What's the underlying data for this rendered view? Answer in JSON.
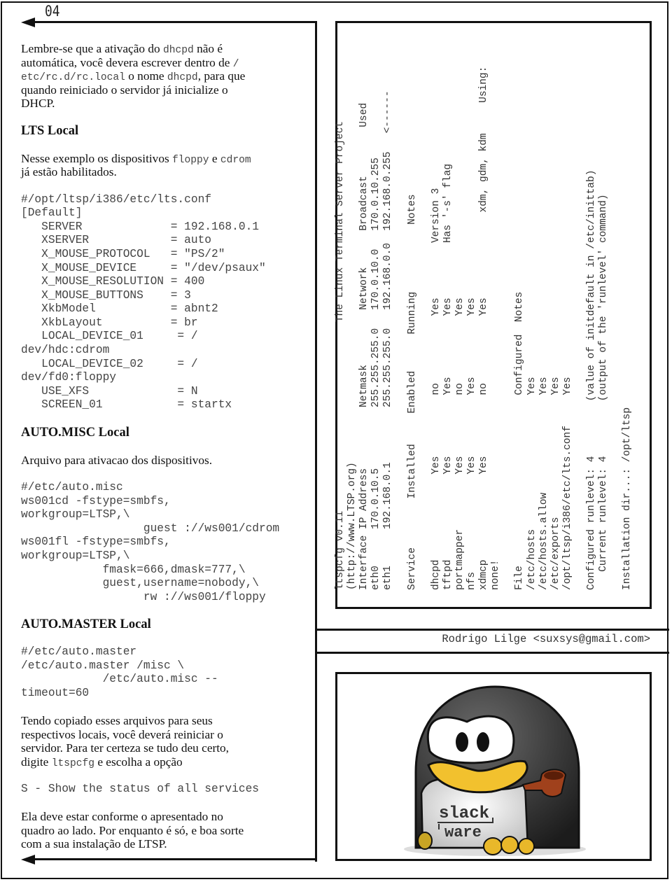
{
  "page_number": "04",
  "left": {
    "blocks": [
      {
        "type": "para",
        "lines": [
          [
            {
              "text": "Lembre-se que a ativação do "
            },
            {
              "text": "dhcpd",
              "code": true
            },
            {
              "text": " não é"
            }
          ],
          [
            {
              "text": "automática, você devera escrever dentro de "
            },
            {
              "text": "/",
              "code": true
            }
          ],
          [
            {
              "text": "etc/rc.d/rc.local",
              "code": true
            },
            {
              "text": " o nome "
            },
            {
              "text": "dhcpd",
              "code": true
            },
            {
              "text": ", para que"
            }
          ],
          [
            {
              "text": "quando reiniciado o servidor já inicialize o"
            }
          ],
          [
            {
              "text": "DHCP."
            }
          ]
        ]
      },
      {
        "type": "heading",
        "text": "LTS Local"
      },
      {
        "type": "para",
        "lines": [
          [
            {
              "text": "Nesse exemplo os dispositivos "
            },
            {
              "text": "floppy",
              "code": true
            },
            {
              "text": " e "
            },
            {
              "text": "cdrom",
              "code": true
            }
          ],
          [
            {
              "text": "já estão habilitados."
            }
          ]
        ]
      },
      {
        "type": "code",
        "lines": [
          "#/opt/ltsp/i386/etc/lts.conf",
          "[Default]",
          "   SERVER             = 192.168.0.1",
          "   XSERVER            = auto",
          "   X_MOUSE_PROTOCOL   = \"PS/2\"",
          "   X_MOUSE_DEVICE     = \"/dev/psaux\"",
          "   X_MOUSE_RESOLUTION = 400",
          "   X_MOUSE_BUTTONS    = 3",
          "   XkbModel           = abnt2",
          "   XkbLayout          = br",
          "   LOCAL_DEVICE_01     = /",
          "dev/hdc:cdrom",
          "   LOCAL_DEVICE_02     = /",
          "dev/fd0:floppy",
          "   USE_XFS             = N",
          "   SCREEN_01           = startx"
        ]
      },
      {
        "type": "heading",
        "text": "AUTO.MISC Local"
      },
      {
        "type": "para",
        "lines": [
          [
            {
              "text": "Arquivo para ativacao dos dispositivos."
            }
          ]
        ]
      },
      {
        "type": "code",
        "lines": [
          "#/etc/auto.misc",
          "ws001cd -fstype=smbfs,",
          "workgroup=LTSP,\\",
          "                  guest ://ws001/cdrom",
          "ws001fl -fstype=smbfs,",
          "workgroup=LTSP,\\",
          "            fmask=666,dmask=777,\\",
          "            guest,username=nobody,\\",
          "                  rw ://ws001/floppy"
        ]
      },
      {
        "type": "heading",
        "text": "AUTO.MASTER Local"
      },
      {
        "type": "code",
        "lines": [
          "#/etc/auto.master",
          "/etc/auto.master /misc \\",
          "            /etc/auto.misc --",
          "timeout=60"
        ]
      },
      {
        "type": "para",
        "lines": [
          [
            {
              "text": "Tendo copiado esses arquivos para seus"
            }
          ],
          [
            {
              "text": "respectivos locais, você deverá reiniciar o"
            }
          ],
          [
            {
              "text": "servidor. Para ter certeza se tudo deu certo,"
            }
          ],
          [
            {
              "text": "digite "
            },
            {
              "text": "ltspcfg",
              "code": true
            },
            {
              "text": " e escolha a opção"
            }
          ]
        ]
      },
      {
        "type": "code",
        "lines": [
          "S - Show the status of all services"
        ]
      },
      {
        "type": "para",
        "lines": [
          [
            {
              "text": "Ela deve estar conforme o apresentado no"
            }
          ],
          [
            {
              "text": "quadro ao lado. Por enquanto é só, e boa sorte"
            }
          ],
          [
            {
              "text": "com a sua instalação de LTSP."
            }
          ]
        ]
      }
    ]
  },
  "status_screen": {
    "lines": [
      "ltspcfg v0.11                               The Linux Terminal Server Project",
      "(http://www.LTSP.org)",
      "Interface IP Address          Netmask         Network      Broadcast        Used",
      "eth0      170.0.10.5          255.255.255.0   170.0.10.0   170.0.10.255",
      "eth1      192.168.0.1         255.255.255.0   192.168.0.0  192.168.0.255   <------",
      "",
      "Service        Installed     Enabled      Running           Notes",
      "",
      "dhcpd              Yes          no           Yes         Version 3",
      "tftpd              Yes          Yes          Yes         Has '-s' flag",
      "portmapper         Yes          no           Yes",
      "nfs                Yes          Yes          Yes",
      "xdmcp              Yes          no           Yes              xdm, gdm, kdm     Using:",
      "none!",
      "",
      "File                            Configured  Notes",
      "/etc/hosts                      Yes",
      "/etc/hosts.allow                Yes",
      "/etc/exports                    Yes",
      "/opt/ltsp/i386/etc/lts.conf     Yes",
      "",
      "Configured runlevel: 4         (value of initdefault in /etc/inittab)",
      "   Current runlevel: 4         (output of the 'runlevel' command)",
      "",
      "Installation dir...: /opt/ltsp"
    ]
  },
  "signature": "Rodrigo Lilge <suxsys@gmail.com>",
  "logo": {
    "text_line1": "slack",
    "text_line2": "ware"
  },
  "colors": {
    "penguin_body": "#3a3a3a",
    "beak": "#f2c12e",
    "pipe": "#a0411c",
    "code_text": "#444444"
  }
}
